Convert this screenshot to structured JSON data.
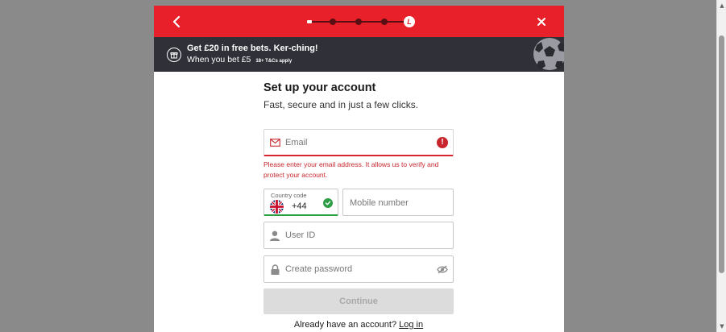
{
  "progress": {
    "current_step_badge": "L",
    "step_count": 5,
    "current_step": 5
  },
  "promo": {
    "title": "Get £20 in free bets. Ker-ching!",
    "subtitle": "When you bet £5",
    "terms": "18+ T&Cs apply"
  },
  "form": {
    "title": "Set up your account",
    "subtitle": "Fast, secure and in just a few clicks.",
    "email": {
      "placeholder": "Email",
      "value": "",
      "state": "error"
    },
    "email_error": "Please enter your email address. It allows us to verify and protect your account.",
    "country": {
      "label": "Country code",
      "code": "+44",
      "state": "valid"
    },
    "mobile": {
      "placeholder": "Mobile number",
      "value": ""
    },
    "user_id": {
      "placeholder": "User ID",
      "value": ""
    },
    "password": {
      "placeholder": "Create password",
      "value": ""
    },
    "continue_label": "Continue",
    "login_prompt": "Already have an account?",
    "login_link": "Log in"
  },
  "colors": {
    "brand_red": "#e8202a",
    "promo_bg": "#2f3038",
    "error": "#c8262c",
    "success": "#2e9e46",
    "disabled_button": "#dcdcdc"
  },
  "icons": [
    "chevron-left-icon",
    "close-icon",
    "gift-icon",
    "football-icon",
    "email-icon",
    "error-icon",
    "uk-flag-icon",
    "check-icon",
    "user-icon",
    "lock-icon",
    "eye-off-icon"
  ]
}
